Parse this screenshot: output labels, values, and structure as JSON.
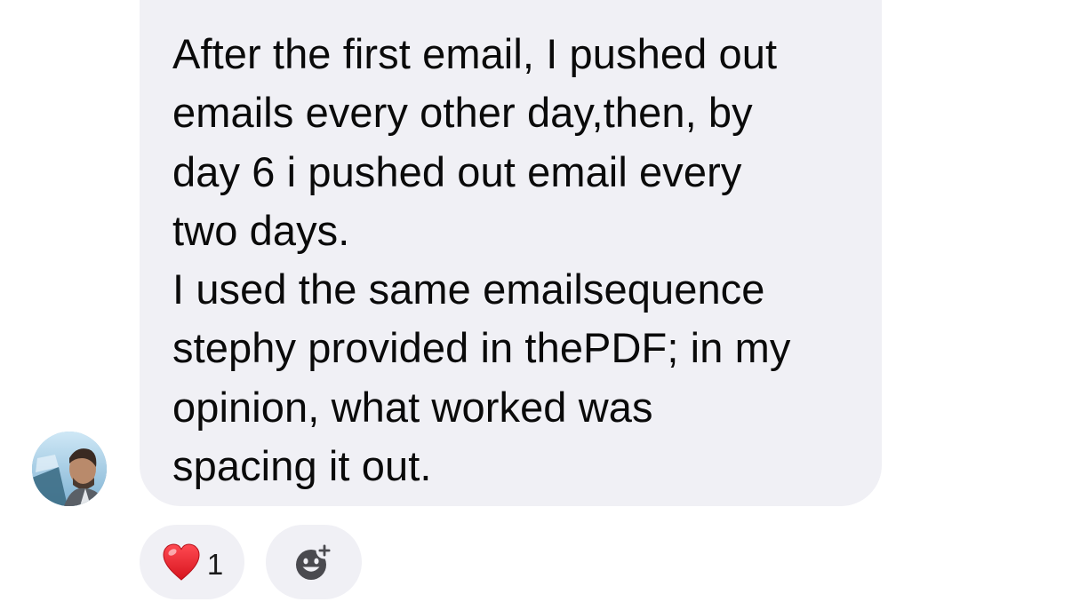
{
  "message": {
    "lines": [
      "After the first email, I pushed out",
      "emails every other day,then, by",
      "day 6 i pushed out email every",
      "two days.",
      "I used the same emailsequence",
      "stephy provided in thePDF; in my",
      "opinion, what worked was",
      "spacing it out."
    ]
  },
  "reactions": {
    "heart_emoji": "❤️",
    "count": "1"
  },
  "icons": {
    "avatar": "profile-photo",
    "reaction": "heart-icon",
    "add_reaction": "smiley-plus-icon"
  },
  "colors": {
    "bubble": "#f0f0f5",
    "text": "#0a0a0a",
    "heart": "#e8202a",
    "icon_gray": "#4a4a4f"
  }
}
